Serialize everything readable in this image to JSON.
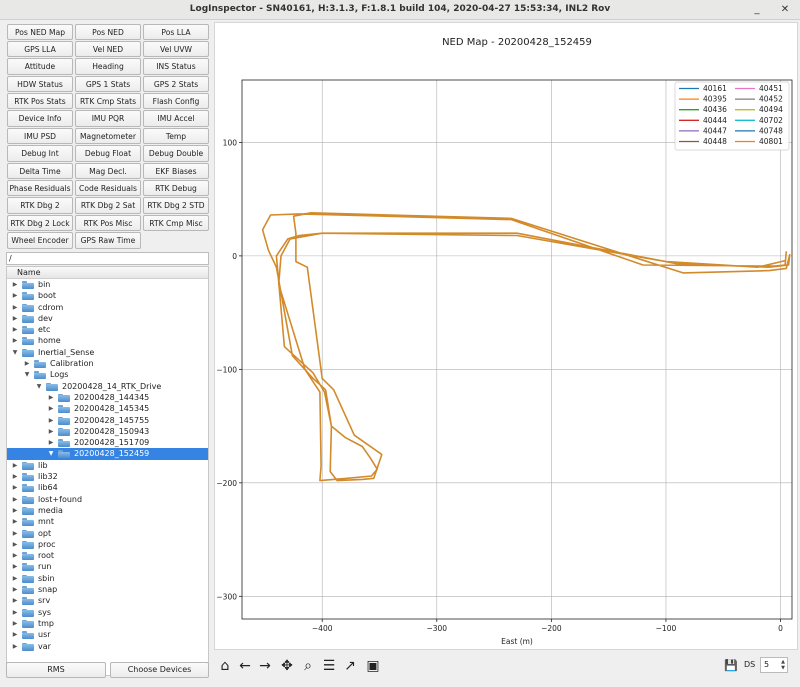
{
  "window": {
    "title": "LogInspector - SN40161, H:3.1.3, F:1.8.1 build 104, 2020-04-27 15:53:34, INL2 Rov",
    "minimize": "_",
    "close": "✕"
  },
  "buttons": [
    "Pos NED Map",
    "Pos NED",
    "Pos LLA",
    "GPS LLA",
    "Vel NED",
    "Vel UVW",
    "Attitude",
    "Heading",
    "INS Status",
    "HDW Status",
    "GPS 1 Stats",
    "GPS 2 Stats",
    "RTK Pos Stats",
    "RTK Cmp Stats",
    "Flash Config",
    "Device Info",
    "IMU PQR",
    "IMU Accel",
    "IMU PSD",
    "Magnetometer",
    "Temp",
    "Debug Int",
    "Debug Float",
    "Debug Double",
    "Delta Time",
    "Mag Decl.",
    "EKF Biases",
    "Phase Residuals",
    "Code Residuals",
    "RTK Debug",
    "RTK Dbg 2",
    "RTK Dbg 2 Sat",
    "RTK Dbg 2 STD",
    "RTK Dbg 2 Lock",
    "RTK Pos Misc",
    "RTK Cmp Misc",
    "Wheel Encoder",
    "GPS Raw Time"
  ],
  "path": "/",
  "tree": {
    "header": "Name",
    "items": [
      {
        "label": "bin",
        "depth": 0,
        "expanded": false
      },
      {
        "label": "boot",
        "depth": 0,
        "expanded": false
      },
      {
        "label": "cdrom",
        "depth": 0,
        "expanded": false
      },
      {
        "label": "dev",
        "depth": 0,
        "expanded": false
      },
      {
        "label": "etc",
        "depth": 0,
        "expanded": false
      },
      {
        "label": "home",
        "depth": 0,
        "expanded": false
      },
      {
        "label": "Inertial_Sense",
        "depth": 0,
        "expanded": true
      },
      {
        "label": "Calibration",
        "depth": 1,
        "expanded": false
      },
      {
        "label": "Logs",
        "depth": 1,
        "expanded": true
      },
      {
        "label": "20200428_14_RTK_Drive",
        "depth": 2,
        "expanded": true
      },
      {
        "label": "20200428_144345",
        "depth": 3,
        "expanded": false
      },
      {
        "label": "20200428_145345",
        "depth": 3,
        "expanded": false
      },
      {
        "label": "20200428_145755",
        "depth": 3,
        "expanded": false
      },
      {
        "label": "20200428_150943",
        "depth": 3,
        "expanded": false
      },
      {
        "label": "20200428_151709",
        "depth": 3,
        "expanded": false
      },
      {
        "label": "20200428_152459",
        "depth": 3,
        "expanded": true,
        "selected": true
      },
      {
        "label": "lib",
        "depth": 0,
        "expanded": false
      },
      {
        "label": "lib32",
        "depth": 0,
        "expanded": false
      },
      {
        "label": "lib64",
        "depth": 0,
        "expanded": false
      },
      {
        "label": "lost+found",
        "depth": 0,
        "expanded": false
      },
      {
        "label": "media",
        "depth": 0,
        "expanded": false
      },
      {
        "label": "mnt",
        "depth": 0,
        "expanded": false
      },
      {
        "label": "opt",
        "depth": 0,
        "expanded": false
      },
      {
        "label": "proc",
        "depth": 0,
        "expanded": false
      },
      {
        "label": "root",
        "depth": 0,
        "expanded": false
      },
      {
        "label": "run",
        "depth": 0,
        "expanded": false
      },
      {
        "label": "sbin",
        "depth": 0,
        "expanded": false
      },
      {
        "label": "snap",
        "depth": 0,
        "expanded": false
      },
      {
        "label": "srv",
        "depth": 0,
        "expanded": false
      },
      {
        "label": "sys",
        "depth": 0,
        "expanded": false
      },
      {
        "label": "tmp",
        "depth": 0,
        "expanded": false
      },
      {
        "label": "usr",
        "depth": 0,
        "expanded": false
      },
      {
        "label": "var",
        "depth": 0,
        "expanded": false
      }
    ]
  },
  "bottom": {
    "rms": "RMS",
    "choose_devices": "Choose Devices"
  },
  "toolbar": {
    "icons": [
      "home-icon",
      "back-icon",
      "forward-icon",
      "pan-icon",
      "zoom-icon",
      "configure-icon",
      "axes-icon",
      "save-icon"
    ],
    "ds_label": "DS",
    "ds_value": "5",
    "save_glyph": "💾"
  },
  "chart_data": {
    "type": "line",
    "title": "NED Map - 20200428_152459",
    "xlabel": "East (m)",
    "ylabel": "",
    "xlim": [
      -470,
      10
    ],
    "ylim": [
      -320,
      155
    ],
    "xticks": [
      -400,
      -300,
      -200,
      -100,
      0
    ],
    "yticks": [
      -300,
      -200,
      -100,
      0,
      100
    ],
    "grid": true,
    "legend_position": "top-right",
    "series": [
      {
        "name": "40161",
        "color": "#1f77b4"
      },
      {
        "name": "40395",
        "color": "#ff7f0e"
      },
      {
        "name": "40436",
        "color": "#2ca02c"
      },
      {
        "name": "40444",
        "color": "#d62728"
      },
      {
        "name": "40447",
        "color": "#9467bd"
      },
      {
        "name": "40448",
        "color": "#8c564b"
      },
      {
        "name": "40451",
        "color": "#e377c2"
      },
      {
        "name": "40452",
        "color": "#7f7f7f"
      },
      {
        "name": "40494",
        "color": "#bcbd22"
      },
      {
        "name": "40702",
        "color": "#17becf"
      },
      {
        "name": "40748",
        "color": "#1f77b4"
      },
      {
        "name": "40801",
        "color": "#ff7f0e"
      }
    ],
    "track": {
      "series": "40801",
      "color": "#d28a2b",
      "x": [
        5,
        4,
        -5,
        -120,
        -235,
        -420,
        -445,
        -452,
        -447,
        -440,
        -426,
        -408,
        -397,
        -392,
        -380,
        -365,
        -358,
        -352,
        -357,
        -378,
        -402,
        -401,
        -402,
        -415,
        -438,
        -436,
        -428,
        -400,
        -230,
        -90,
        -10,
        7,
        8,
        5,
        -10,
        -85,
        -235,
        -410,
        -425,
        -423,
        -423,
        -413,
        -400,
        -390,
        -372,
        -348,
        -355,
        -365,
        -387,
        -393,
        -392,
        -398,
        -408,
        -433,
        -440,
        -430,
        -420,
        -400,
        -230,
        -100,
        -20,
        5
      ],
      "y": [
        4,
        -8,
        -9,
        -8,
        32,
        37,
        36,
        23,
        5,
        -10,
        -88,
        -108,
        -118,
        -150,
        -160,
        -168,
        -178,
        -188,
        -194,
        -196,
        -198,
        -185,
        -120,
        -100,
        -25,
        0,
        15,
        20,
        20,
        -7,
        -10,
        -8,
        1,
        -11,
        -13,
        -15,
        33,
        38,
        35,
        20,
        -5,
        -10,
        -108,
        -118,
        -158,
        -175,
        -196,
        -197,
        -198,
        -190,
        -150,
        -120,
        -103,
        -80,
        0,
        15,
        18,
        20,
        18,
        -5,
        -10,
        -4
      ]
    }
  }
}
